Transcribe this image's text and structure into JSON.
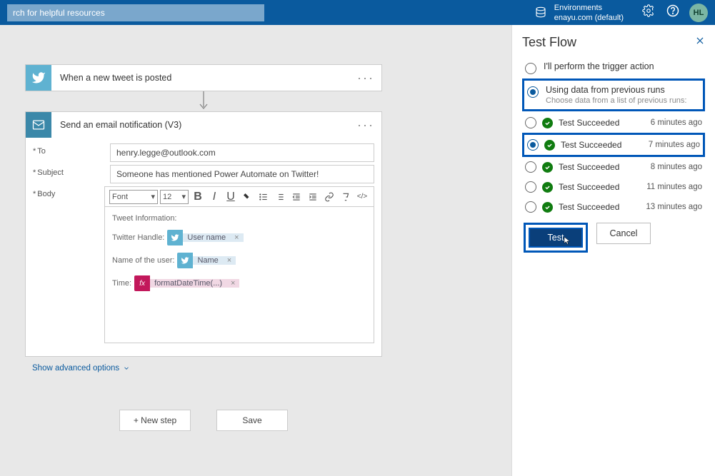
{
  "header": {
    "search_placeholder": "rch for helpful resources",
    "env_label": "Environments",
    "env_name": "enayu.com (default)",
    "avatar_initials": "HL"
  },
  "flow": {
    "trigger_title": "When a new tweet is posted",
    "action_title": "Send an email notification (V3)",
    "fields": {
      "to_label": "To",
      "to_value": "henry.legge@outlook.com",
      "subject_label": "Subject",
      "subject_value": "Someone has mentioned Power Automate on Twitter!",
      "body_label": "Body"
    },
    "toolbar": {
      "font_label": "Font",
      "size_label": "12"
    },
    "body": {
      "line1": "Tweet Information:",
      "handle_label": "Twitter Handle:",
      "handle_token": "User name",
      "username_label": "Name of the user:",
      "username_token": "Name",
      "time_label": "Time:",
      "time_token": "formatDateTime(...)"
    },
    "advanced": "Show advanced options",
    "new_step": "+ New step",
    "save": "Save"
  },
  "panel": {
    "title": "Test Flow",
    "opt1": "I'll perform the trigger action",
    "opt2": "Using data from previous runs",
    "opt2_sub": "Choose data from a list of previous runs:",
    "runs": [
      {
        "label": "Test Succeeded",
        "time": "6 minutes ago",
        "selected": false
      },
      {
        "label": "Test Succeeded",
        "time": "7 minutes ago",
        "selected": true
      },
      {
        "label": "Test Succeeded",
        "time": "8 minutes ago",
        "selected": false
      },
      {
        "label": "Test Succeeded",
        "time": "11 minutes ago",
        "selected": false
      },
      {
        "label": "Test Succeeded",
        "time": "13 minutes ago",
        "selected": false
      }
    ],
    "test_btn": "Test",
    "cancel_btn": "Cancel"
  }
}
